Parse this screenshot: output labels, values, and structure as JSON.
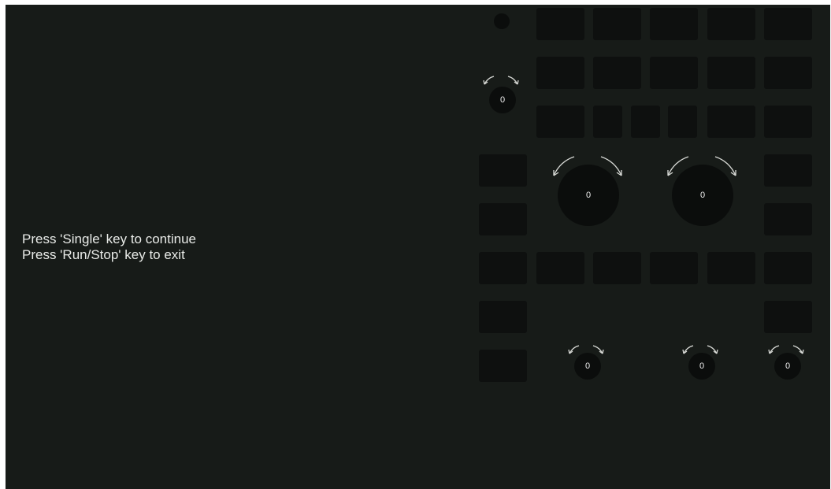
{
  "message": {
    "line1": "Press 'Single' key to continue",
    "line2": "Press 'Run/Stop' key to exit"
  },
  "knobs": {
    "top_small": "0",
    "large_left": "0",
    "large_right": "0",
    "bottom_left": "0",
    "bottom_middle": "0",
    "bottom_right": "0"
  },
  "colors": {
    "background": "#171b18",
    "key": "#0e100f",
    "text": "#e9ebe8"
  },
  "icons": {
    "knob_rotation": "rotate-arrows-icon"
  }
}
